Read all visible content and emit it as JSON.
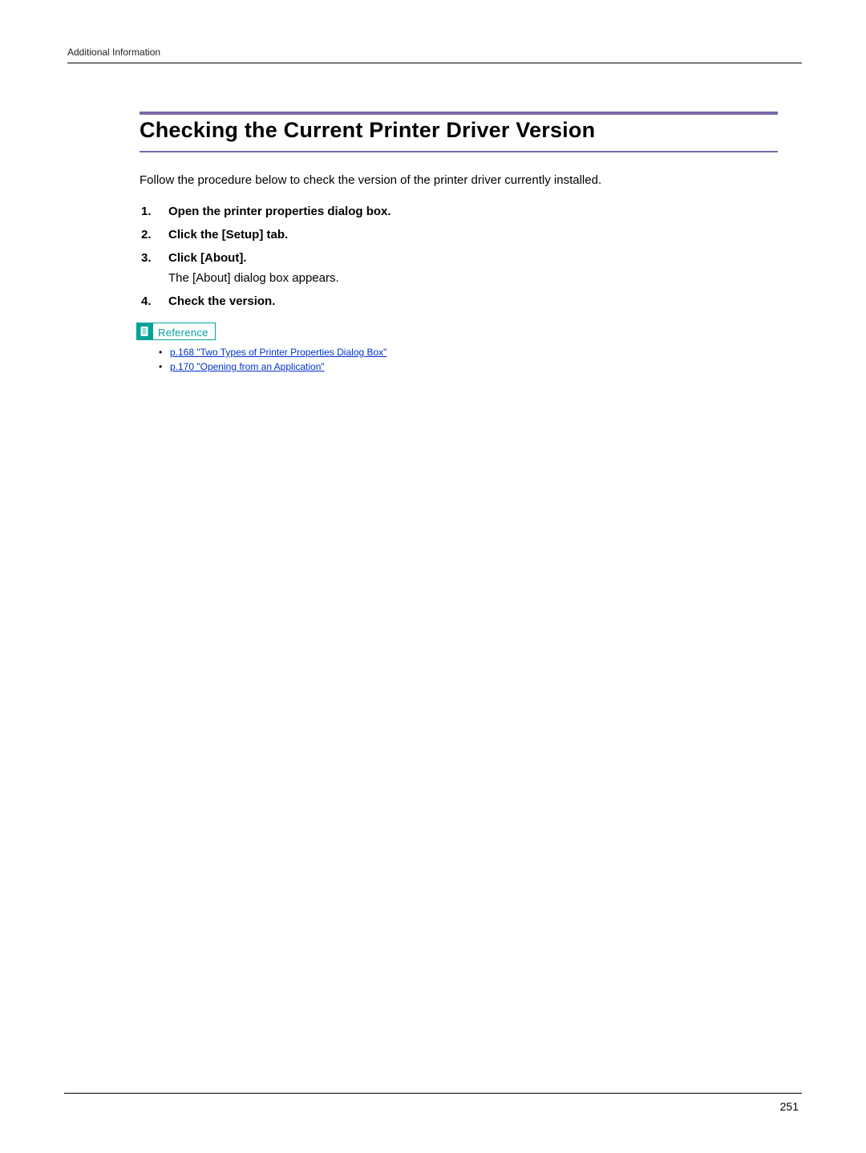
{
  "header": {
    "chapter": "Additional Information"
  },
  "title": "Checking the Current Printer Driver Version",
  "intro": "Follow the procedure below to check the version of the printer driver currently installed.",
  "steps": [
    {
      "text": "Open the printer properties dialog box."
    },
    {
      "text": "Click the [Setup] tab."
    },
    {
      "text": "Click [About].",
      "sub": "The [About] dialog box appears."
    },
    {
      "text": "Check the version."
    }
  ],
  "reference": {
    "label": "Reference",
    "links": [
      "p.168 \"Two Types of Printer Properties Dialog Box\"",
      "p.170 \"Opening from an Application\""
    ]
  },
  "page_number": "251"
}
